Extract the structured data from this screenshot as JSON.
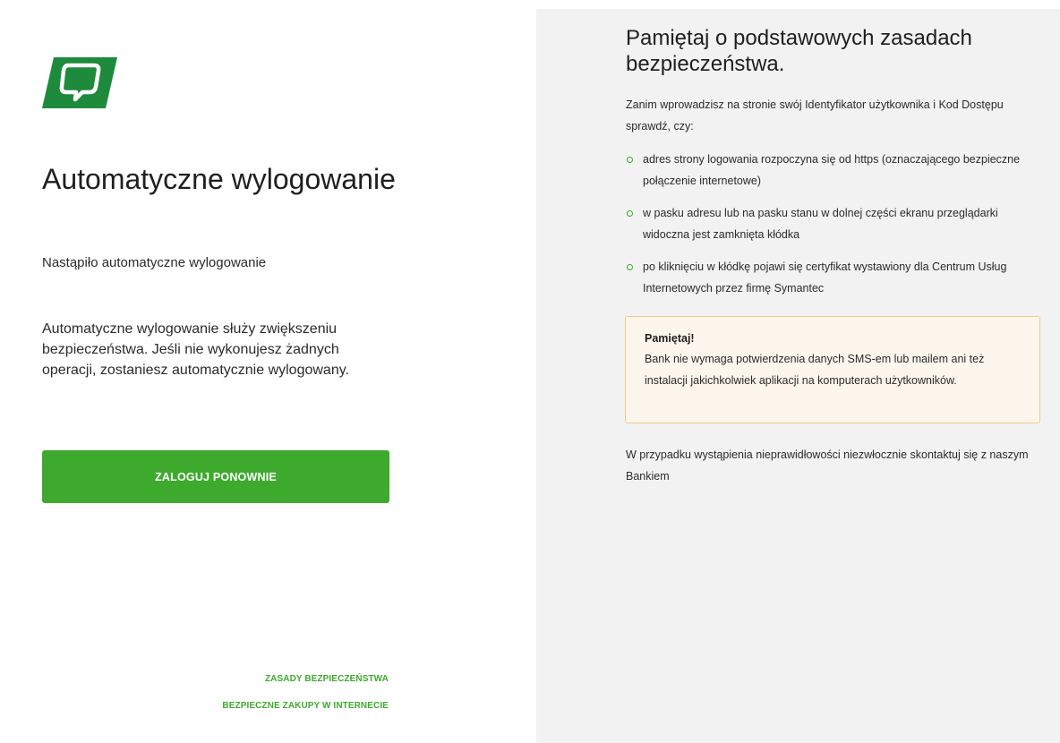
{
  "brand": {
    "logo_icon": "bank-logo-speech-bubble-icon",
    "primary_color": "#1e8a3c",
    "accent_color": "#3daa2e"
  },
  "left": {
    "title": "Automatyczne wylogowanie",
    "subtitle": "Nastąpiło automatyczne wylogowanie",
    "description": "Automatyczne wylogowanie służy zwiększeniu bezpieczeństwa. Jeśli nie wykonujesz żadnych operacji, zostaniesz automatycznie wylogowany.",
    "relogin_button": "ZALOGUJ PONOWNIE",
    "footer_links": [
      "ZASADY BEZPIECZEŃSTWA",
      "BEZPIECZNE ZAKUPY W INTERNECIE"
    ]
  },
  "security": {
    "heading": "Pamiętaj o podstawowych zasadach bezpieczeństwa.",
    "intro": "Zanim wprowadzisz na stronie swój Identyfikator użytkownika i Kod Dostępu sprawdź, czy:",
    "checklist": [
      "adres strony logowania rozpoczyna się od https (oznaczającego bezpieczne połączenie internetowe)",
      "w pasku adresu lub na pasku stanu w dolnej części ekranu przeglądarki widoczna jest zamknięta kłódka",
      "po kliknięciu w kłódkę pojawi się certyfikat wystawiony dla Centrum Usług Internetowych przez firmę Symantec"
    ],
    "notice": {
      "title": "Pamiętaj!",
      "body": "Bank nie wymaga potwierdzenia danych SMS-em lub mailem ani też instalacji jakichkolwiek aplikacji na komputerach użytkowników."
    },
    "footer": "W przypadku wystąpienia nieprawidłowości niezwłocznie skontaktuj się z naszym Bankiem"
  }
}
